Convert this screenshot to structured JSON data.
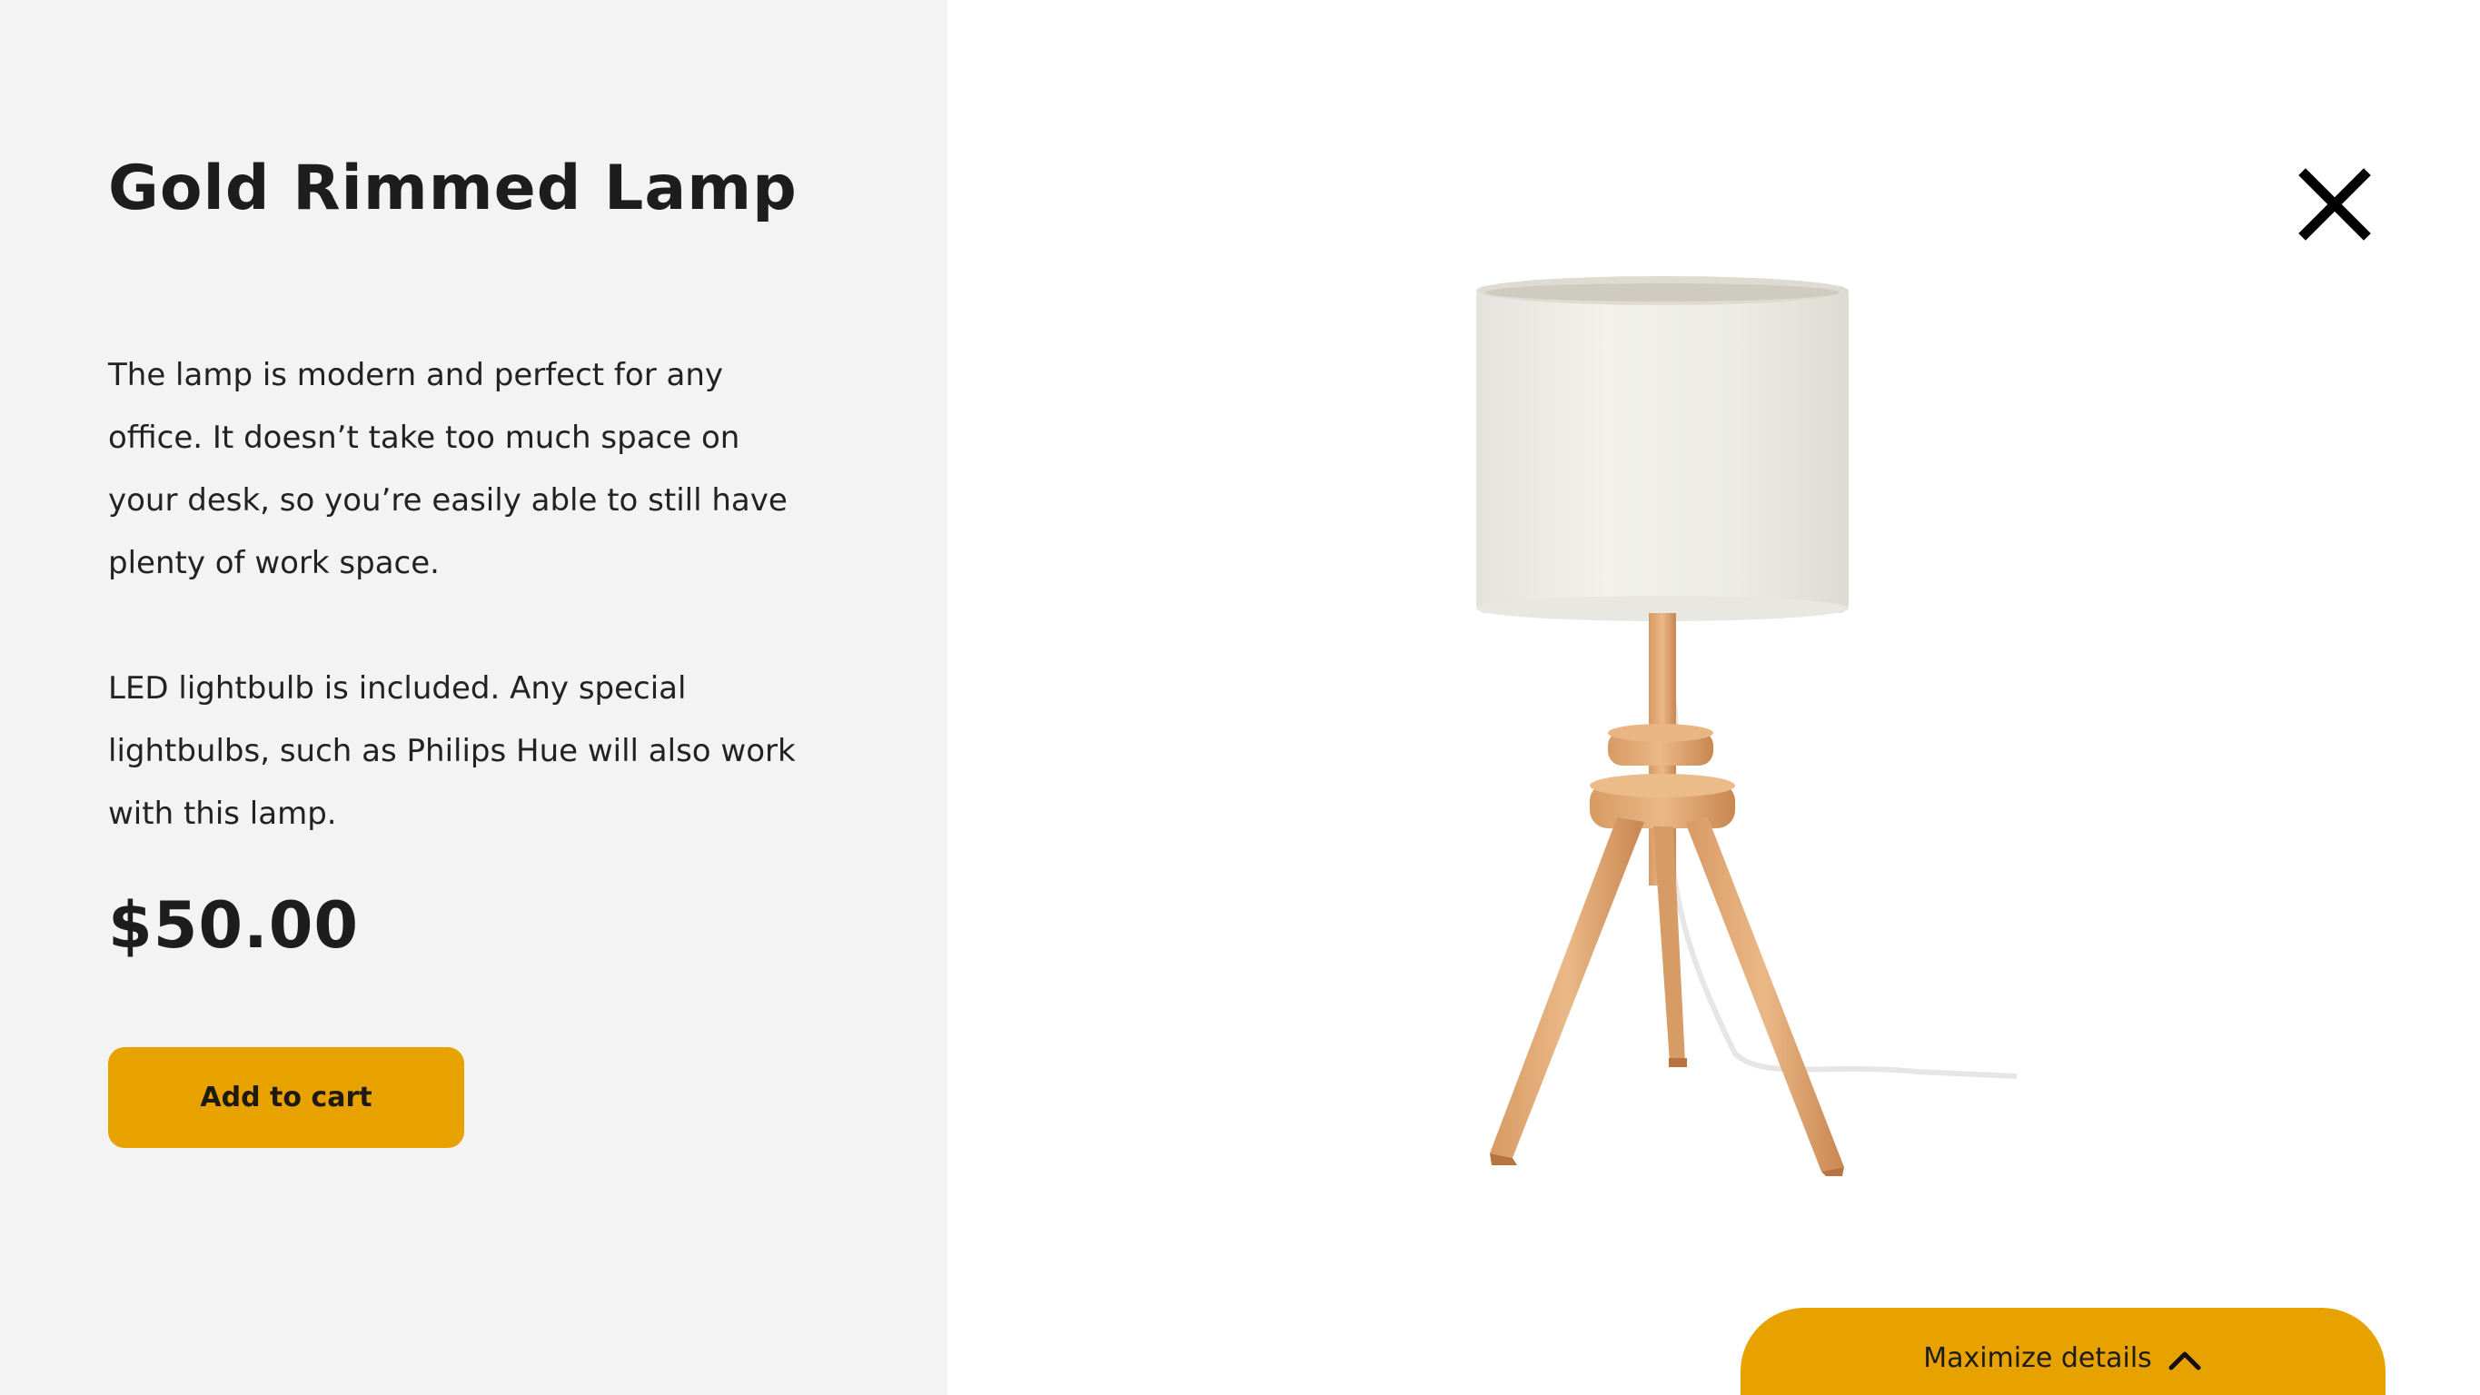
{
  "product": {
    "title": "Gold Rimmed Lamp",
    "description_1": "The lamp is modern and perfect for any office. It doesn’t take too much space on your desk, so you’re easily able to still have plenty of work space.",
    "description_2": "LED lightbulb is included. Any special lightbulbs, such as Philips Hue will also work with this lamp.",
    "price": "$50.00",
    "image_icon": "table-lamp"
  },
  "actions": {
    "add_to_cart_label": "Add to cart",
    "maximize_label": "Maximize details",
    "close_icon": "close-icon",
    "maximize_icon": "chevron-up-icon"
  },
  "colors": {
    "accent": "#e8a200",
    "panel_bg": "#f3f3f3",
    "text": "#1d1d1d"
  }
}
